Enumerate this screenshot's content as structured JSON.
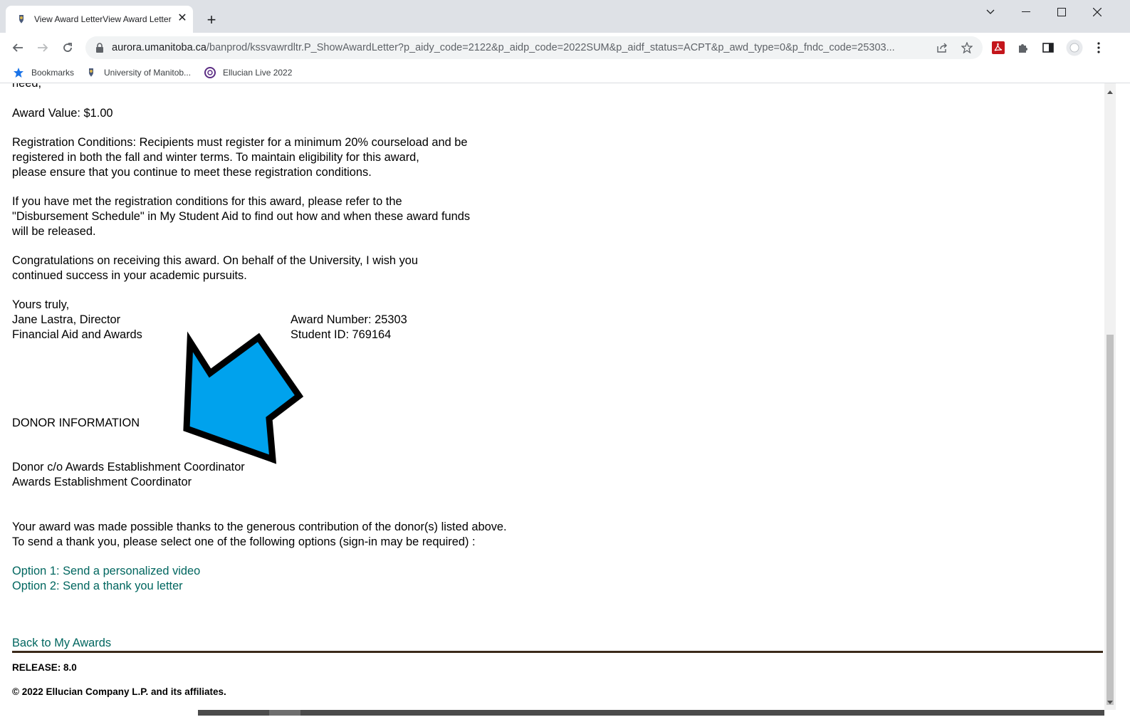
{
  "browser": {
    "tab_title": "View Award LetterView Award Letter",
    "new_tab_label": "+",
    "url_host": "aurora.umanitoba.ca",
    "url_path": "/banprod/kssvawrdltr.P_ShowAwardLetter?p_aidy_code=2122&p_aidp_code=2022SUM&p_aidf_status=ACPT&p_awd_type=0&p_fndc_code=25303...",
    "bookmarks": [
      {
        "label": "Bookmarks",
        "icon": "star-icon"
      },
      {
        "label": "University of Manitob...",
        "icon": "university-crest-icon"
      },
      {
        "label": "Ellucian Live 2022",
        "icon": "ellucian-icon"
      }
    ]
  },
  "letter": {
    "cut_top_text": "need,",
    "award_value": "Award Value: $1.00",
    "reg_conditions": [
      "Registration Conditions: Recipients must register for a minimum 20% courseload and be",
      "registered in both the fall and winter terms. To maintain eligibility for this award,",
      "please ensure that you continue to meet these registration conditions."
    ],
    "disbursement": [
      "If you have met the registration conditions for this award, please refer to the",
      "\"Disbursement Schedule\" in My Student Aid to find out how and when these award funds",
      "will be released."
    ],
    "congrats": [
      "Congratulations on receiving this award. On behalf of the University, I wish you",
      "continued success in your academic pursuits."
    ],
    "closing": "Yours truly,",
    "signer_name": "Jane Lastra, Director",
    "signer_dept": "Financial Aid and Awards",
    "award_number": "Award Number: 25303",
    "student_id": "Student ID: 769164"
  },
  "donor": {
    "heading": "DONOR INFORMATION",
    "line1": "Donor c/o Awards Establishment Coordinator",
    "line2": "Awards Establishment Coordinator",
    "thanks1": "Your award was made possible thanks to the generous contribution of the donor(s) listed above.",
    "thanks2": "To send a thank you, please select one of the following options (sign-in may be required) :",
    "option1": "Option 1: Send a personalized video",
    "option2": "Option 2: Send a thank you letter"
  },
  "footer": {
    "back_link": "Back to My Awards",
    "release": "RELEASE: 8.0",
    "copyright": "© 2022 Ellucian Company L.P. and its affiliates."
  },
  "colors": {
    "link": "#00665f",
    "annotation_arrow_fill": "#00a2ed",
    "rule": "#3b2a1a"
  }
}
